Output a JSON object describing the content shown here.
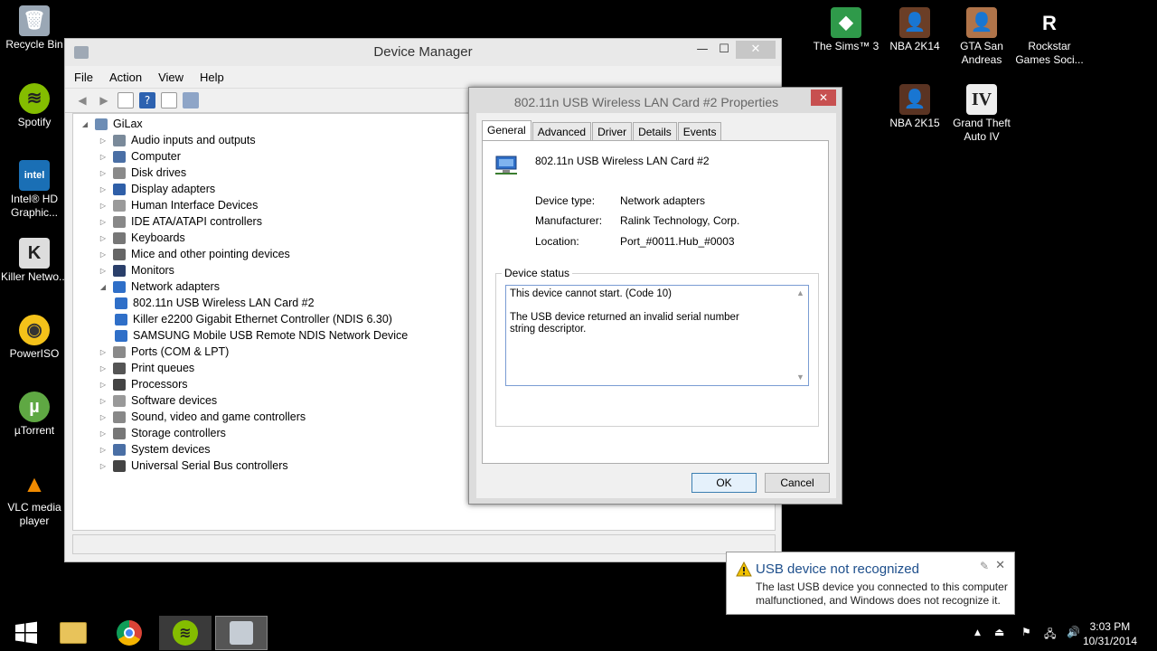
{
  "desktop": {
    "left_icons": [
      {
        "label": "Recycle Bin"
      },
      {
        "label": "Spotify"
      },
      {
        "label": "Intel® HD Graphic..."
      },
      {
        "label": "Killer Netwo..."
      },
      {
        "label": "PowerISO"
      },
      {
        "label": "µTorrent"
      },
      {
        "label": "VLC media player"
      }
    ],
    "right_icons": [
      {
        "label": "The Sims™ 3"
      },
      {
        "label": "NBA 2K14"
      },
      {
        "label": "GTA San Andreas"
      },
      {
        "label": "Rockstar Games Soci..."
      },
      {
        "label": "NBA 2K15"
      },
      {
        "label": "Grand Theft Auto IV"
      }
    ]
  },
  "device_manager": {
    "title": "Device Manager",
    "menu": [
      "File",
      "Action",
      "View",
      "Help"
    ],
    "root": "GiLax",
    "items": [
      "Audio inputs and outputs",
      "Computer",
      "Disk drives",
      "Display adapters",
      "Human Interface Devices",
      "IDE ATA/ATAPI controllers",
      "Keyboards",
      "Mice and other pointing devices",
      "Monitors",
      "Network adapters",
      "802.11n USB Wireless LAN Card #2",
      "Killer e2200 Gigabit Ethernet Controller (NDIS 6.30)",
      "SAMSUNG Mobile USB Remote NDIS Network Device",
      "Ports (COM & LPT)",
      "Print queues",
      "Processors",
      "Software devices",
      "Sound, video and game controllers",
      "Storage controllers",
      "System devices",
      "Universal Serial Bus controllers"
    ]
  },
  "properties": {
    "title": "802.11n USB Wireless LAN Card #2 Properties",
    "tabs": [
      "General",
      "Advanced",
      "Driver",
      "Details",
      "Events"
    ],
    "device_name": "802.11n USB Wireless LAN Card #2",
    "device_type_label": "Device type:",
    "device_type": "Network adapters",
    "manufacturer_label": "Manufacturer:",
    "manufacturer": "Ralink Technology, Corp.",
    "location_label": "Location:",
    "location": "Port_#0011.Hub_#0003",
    "status_group": "Device status",
    "status_line1": "This device cannot start. (Code 10)",
    "status_line2": "The USB device returned an invalid serial number string descriptor.",
    "ok": "OK",
    "cancel": "Cancel"
  },
  "toast": {
    "title": "USB device not recognized",
    "body": "The last USB device you connected to this computer malfunctioned, and Windows does not recognize it."
  },
  "clock": {
    "time": "3:03 PM",
    "date": "10/31/2014"
  }
}
